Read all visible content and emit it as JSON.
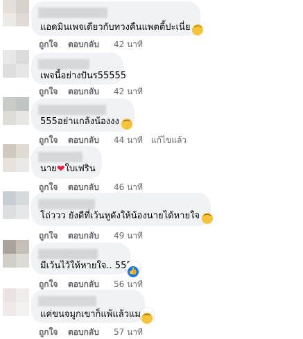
{
  "comments": [
    {
      "text": "แอดมินเพจเดียวกับทวงคืนแพตตี้ปะเนี่ย",
      "trailing_emoji": "laughing-emoji",
      "like": "ถูกใจ",
      "reply": "ตอบกลับ",
      "time": "42 นาที",
      "edited": ""
    },
    {
      "text": "เพจนี้อย่างปันร55555",
      "trailing_emoji": "",
      "like": "ถูกใจ",
      "reply": "ตอบกลับ",
      "time": "42 นาที",
      "edited": ""
    },
    {
      "text": "555อย่าแกล้งน้องงง",
      "trailing_emoji": "laughing-emoji",
      "like": "ถูกใจ",
      "reply": "ตอบกลับ",
      "time": "44 นาที",
      "edited": "แก้ไขแล้ว"
    },
    {
      "text": "นาย",
      "heart_text": "ใบเฟริน",
      "like": "ถูกใจ",
      "reply": "ตอบกลับ",
      "time": "46 นาที",
      "edited": ""
    },
    {
      "text": "โถ่ววว ยังดีที่เว้นหูดังให้น้องนายได้หายใจ",
      "trailing_emoji": "laughing-emoji",
      "like": "ถูกใจ",
      "reply": "ตอบกลับ",
      "time": "49 นาที",
      "edited": ""
    },
    {
      "text": "มีเว้นไว้ให้หายใจ.. 555",
      "reaction": "like-icon",
      "like": "ถูกใจ",
      "reply": "ตอบกลับ",
      "time": "56 นาที",
      "edited": ""
    },
    {
      "text": "แค่ขนจมูกเขาก็แพ้แล้วแมะ",
      "reaction": "laughing-emoji",
      "like": "ถูกใจ",
      "reply": "ตอบกลับ",
      "time": "57 นาที",
      "edited": ""
    }
  ],
  "colors": {
    "bubble": "#f0f2f5",
    "meta": "#65676b",
    "like_blue": "#1877f2",
    "laugh_yellow": "#f7c33b",
    "heart_red": "#e41e3f"
  }
}
